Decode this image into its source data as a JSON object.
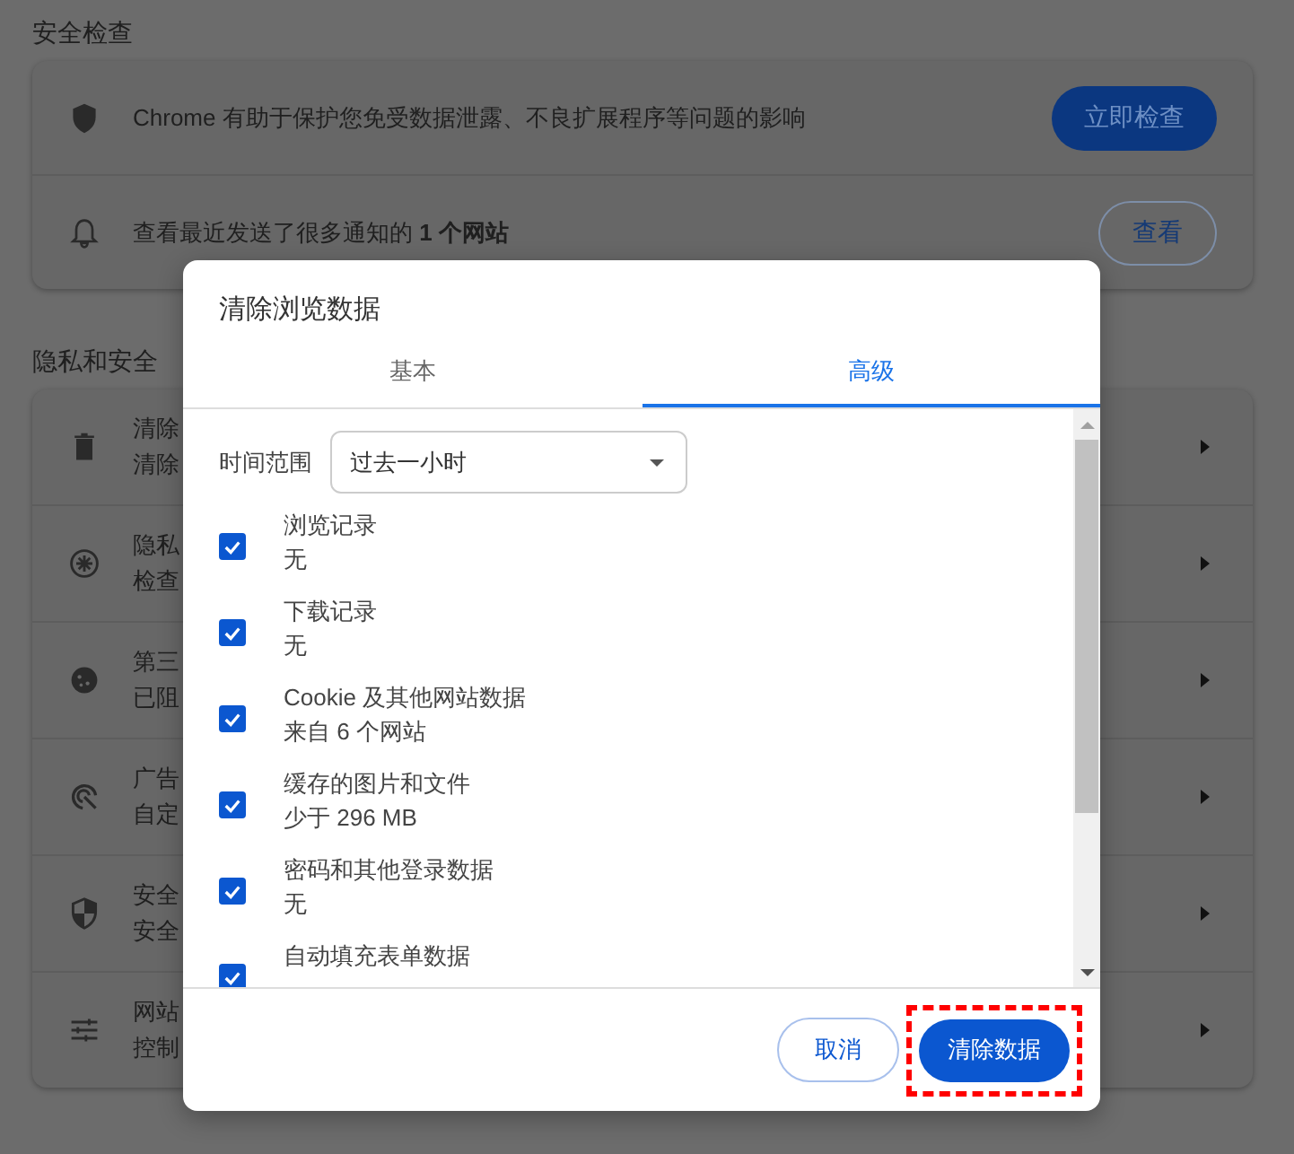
{
  "background": {
    "sections": [
      {
        "heading": "安全检查",
        "rows": [
          {
            "kind": "action",
            "text": "Chrome 有助于保护您免受数据泄露、不良扩展程序等问题的影响",
            "button": {
              "label": "立即检查",
              "kind": "primary"
            }
          },
          {
            "kind": "action",
            "text": "查看最近发送了很多通知的 **1 个网站**",
            "button": {
              "label": "查看",
              "kind": "secondary"
            }
          }
        ]
      },
      {
        "heading": "隐私和安全",
        "rows": [
          {
            "kind": "link",
            "title": "清除",
            "subtitle": "清除"
          },
          {
            "kind": "link",
            "title": "隐私",
            "subtitle": "检查"
          },
          {
            "kind": "link",
            "title": "第三",
            "subtitle": "已阻"
          },
          {
            "kind": "link",
            "title": "广告",
            "subtitle": "自定"
          },
          {
            "kind": "link",
            "title": "安全",
            "subtitle": "安全"
          },
          {
            "kind": "link",
            "title": "网站",
            "subtitle": "控制"
          }
        ]
      }
    ]
  },
  "dialog": {
    "title": "清除浏览数据",
    "tabs": [
      {
        "label": "基本",
        "selected": false
      },
      {
        "label": "高级",
        "selected": true
      }
    ],
    "time_range": {
      "label": "时间范围",
      "value": "过去一小时"
    },
    "items": [
      {
        "label": "浏览记录",
        "detail": "无",
        "checked": true
      },
      {
        "label": "下载记录",
        "detail": "无",
        "checked": true
      },
      {
        "label": "Cookie 及其他网站数据",
        "detail": "来自 6 个网站",
        "checked": true
      },
      {
        "label": "缓存的图片和文件",
        "detail": "少于 296 MB",
        "checked": true
      },
      {
        "label": "密码和其他登录数据",
        "detail": "无",
        "checked": true
      },
      {
        "label": "自动填充表单数据",
        "checked": true
      }
    ],
    "buttons": [
      {
        "label": "取消",
        "kind": "secondary",
        "highlighted": false
      },
      {
        "label": "清除数据",
        "kind": "primary",
        "highlighted": true
      }
    ]
  }
}
